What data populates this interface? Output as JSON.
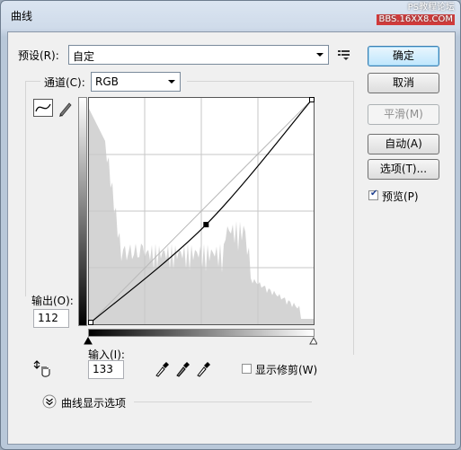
{
  "window": {
    "title": "曲线",
    "watermark_top": "PS教程论坛",
    "watermark_bottom": "BBS.16XX8.COM"
  },
  "preset": {
    "label": "预设(R):",
    "value": "自定",
    "menu_icon": "preset-options-icon"
  },
  "channel": {
    "label": "通道(C):",
    "value": "RGB"
  },
  "buttons": {
    "ok": "确定",
    "cancel": "取消",
    "smooth": "平滑(M)",
    "auto": "自动(A)",
    "options": "选项(T)..."
  },
  "preview": {
    "label": "预览(P)",
    "checked": true
  },
  "output": {
    "label": "输出(O):",
    "value": "112"
  },
  "input": {
    "label": "输入(I):",
    "value": "133"
  },
  "show_clipping": {
    "label": "显示修剪(W)",
    "checked": false
  },
  "curve_display_options": {
    "label": "曲线显示选项"
  },
  "curve": {
    "control_points": [
      [
        0,
        0
      ],
      [
        133,
        112
      ],
      [
        255,
        255
      ]
    ],
    "selected_point": [
      133,
      112
    ]
  },
  "icons": {
    "curve_tool": "curve-tool-icon",
    "pencil_tool": "pencil-tool-icon",
    "hand_adjust": "targeted-adjust-icon",
    "black_eyedropper": "eyedropper-black-icon",
    "gray_eyedropper": "eyedropper-gray-icon",
    "white_eyedropper": "eyedropper-white-icon",
    "expand": "chevron-down-circle-icon"
  }
}
